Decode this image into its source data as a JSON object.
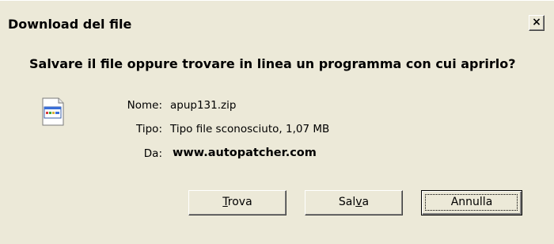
{
  "window": {
    "title": "Download del file",
    "close_glyph": "×"
  },
  "prompt": {
    "question": "Salvare il file oppure trovare in linea un programma con cui aprirlo?"
  },
  "file_icon": "generic-file-icon",
  "fields": {
    "name_label": "Nome:",
    "name_value": "apup131.zip",
    "type_label": "Tipo:",
    "type_value": "Tipo file sconosciuto, 1,07 MB",
    "from_label": "Da:",
    "from_value": "www.autopatcher.com"
  },
  "buttons": {
    "find": {
      "pre": "",
      "accel": "T",
      "post": "rova"
    },
    "save": {
      "pre": "Sal",
      "accel": "v",
      "post": "a"
    },
    "cancel": {
      "label": "Annulla"
    }
  },
  "colors": {
    "dialog_bg": "#ece9d8",
    "text": "#000000"
  }
}
